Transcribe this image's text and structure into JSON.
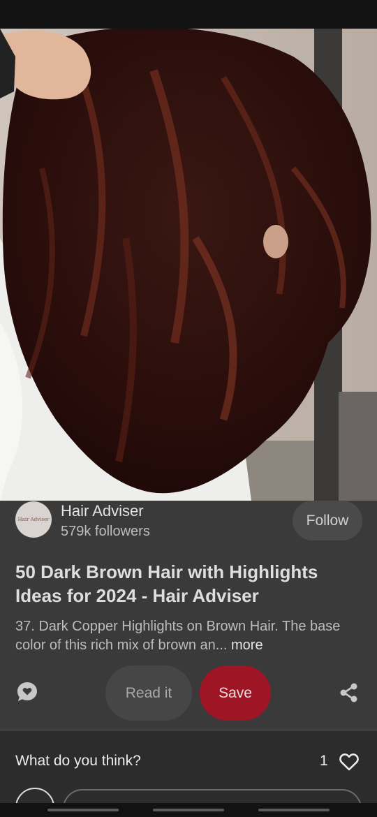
{
  "pin": {
    "image_icon": "pin-photo"
  },
  "creator": {
    "avatar_text": "Hair Adviser",
    "name": "Hair Adviser",
    "followers": "579k followers",
    "follow_label": "Follow"
  },
  "details": {
    "title": "50 Dark Brown Hair with Highlights Ideas for 2024 - Hair Adviser",
    "description": "37. Dark Copper Highlights on Brown Hair. The base color of this rich mix of brown an...",
    "more_label": "more"
  },
  "actions": {
    "comment_icon": "comment-bubble-icon",
    "read_label": "Read it",
    "save_label": "Save",
    "share_icon": "share-icon"
  },
  "comments": {
    "prompt": "What do you think?",
    "like_count": "1",
    "heart_icon": "heart-outline-icon"
  },
  "colors": {
    "save_button": "#9e1525",
    "panel": "#3a3a3a",
    "bottom_panel": "#2c2c2c"
  }
}
